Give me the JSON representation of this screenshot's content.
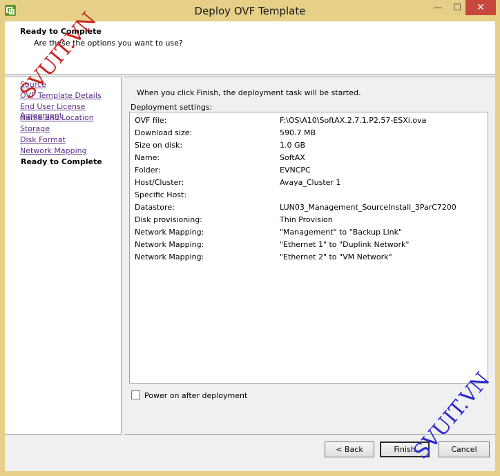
{
  "window": {
    "title": "Deploy OVF Template",
    "controls": {
      "minimize": "—",
      "maximize": "☐",
      "close": "✕"
    }
  },
  "header": {
    "title": "Ready to Complete",
    "subtitle": "Are these the options you want to use?"
  },
  "steps": [
    {
      "label": "Source",
      "current": false
    },
    {
      "label": "OVF Template Details",
      "current": false
    },
    {
      "label": "End User License Agreement",
      "current": false
    },
    {
      "label": "Name and Location",
      "current": false
    },
    {
      "label": "Storage",
      "current": false
    },
    {
      "label": "Disk Format",
      "current": false
    },
    {
      "label": "Network Mapping",
      "current": false
    },
    {
      "label": "Ready to Complete",
      "current": true
    }
  ],
  "main": {
    "intro": "When you click Finish, the deployment task will be started.",
    "settings_label": "Deployment settings:",
    "settings": [
      {
        "key": "OVF file:",
        "value": "F:\\OS\\A10\\SoftAX.2.7.1.P2.57-ESXi.ova"
      },
      {
        "key": "Download size:",
        "value": "590.7 MB"
      },
      {
        "key": "Size on disk:",
        "value": "1.0 GB"
      },
      {
        "key": "Name:",
        "value": "SoftAX"
      },
      {
        "key": "Folder:",
        "value": "EVNCPC"
      },
      {
        "key": "Host/Cluster:",
        "value": "Avaya_Cluster 1"
      },
      {
        "key": "Specific Host:",
        "value": ""
      },
      {
        "key": "Datastore:",
        "value": "LUN03_Management_SourceInstall_3ParC7200"
      },
      {
        "key": "Disk provisioning:",
        "value": "Thin Provision"
      },
      {
        "key": "Network Mapping:",
        "value": "\"Management\" to \"Backup Link\""
      },
      {
        "key": "Network Mapping:",
        "value": "\"Ethernet 1\" to \"Duplink Network\""
      },
      {
        "key": "Network Mapping:",
        "value": "\"Ethernet 2\" to \"VM Network\""
      }
    ],
    "power_on_label": "Power on after deployment",
    "power_on_checked": false
  },
  "buttons": {
    "back": "< Back",
    "finish": "Finish",
    "cancel": "Cancel"
  },
  "watermark": "SVUIT.VN"
}
